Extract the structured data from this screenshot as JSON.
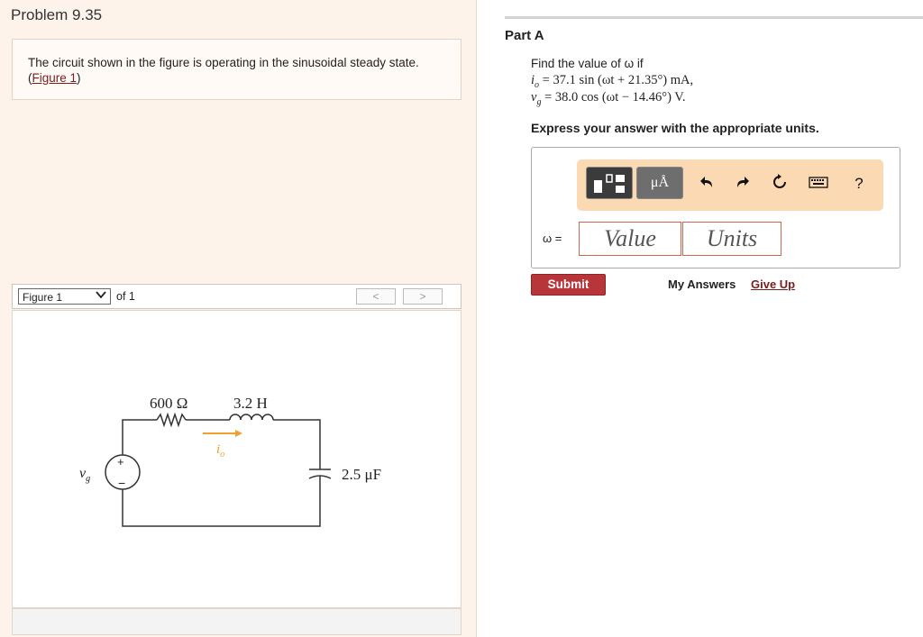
{
  "problem": {
    "title": "Problem 9.35",
    "text": "The circuit shown in the figure is operating in the sinusoidal steady state.",
    "figure_link_open": "(",
    "figure_link": "Figure 1",
    "figure_link_close": ")"
  },
  "figure_nav": {
    "selected": "Figure 1",
    "of_label": "of 1",
    "prev_label": "<",
    "next_label": ">"
  },
  "circuit": {
    "resistor": "600 Ω",
    "inductor": "3.2 H",
    "capacitor": "2.5 μF",
    "current_label": "i",
    "current_sub": "o",
    "source_label": "v",
    "source_sub": "g",
    "plus": "+",
    "minus": "−"
  },
  "part_a": {
    "title": "Part A",
    "prompt": "Find the value of ω if",
    "eq1": "i",
    "eq1_sub": "o",
    "eq1_rhs": "= 37.1 sin (ωt + 21.35°) mA,",
    "eq2": "v",
    "eq2_sub": "g",
    "eq2_rhs": "= 38.0 cos (ωt − 14.46°) V.",
    "instruction": "Express your answer with the appropriate units.",
    "answer_label": "ω =",
    "value_placeholder": "Value",
    "units_placeholder": "Units",
    "units_button": "μÅ",
    "toolbar_icons": [
      "templates-icon",
      "units-icon",
      "undo-icon",
      "redo-icon",
      "reset-icon",
      "keyboard-icon",
      "help-icon"
    ],
    "help_label": "?"
  },
  "actions": {
    "submit": "Submit",
    "my_answers": "My Answers",
    "give_up": "Give Up"
  },
  "colors": {
    "left_panel_bg": "#fdf3ea",
    "toolbar_bg": "#fbd9b3",
    "submit_bg": "#b8353a",
    "link": "#7a1c1c",
    "input_border": "#c46a4f",
    "current_arrow": "#f0a030"
  }
}
